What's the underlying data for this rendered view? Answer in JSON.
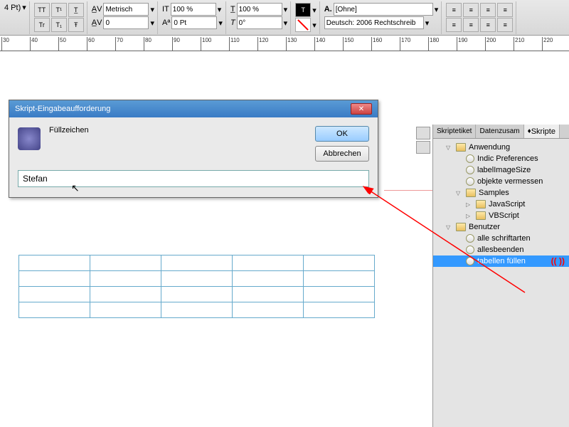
{
  "toolbar": {
    "pt_label": "4 Pt)",
    "metric": "Metrisch",
    "percent": "100 %",
    "zero_pt": "0 Pt",
    "zero_deg": "0°",
    "none": "[Ohne]",
    "lang": "Deutsch: 2006 Rechtschreib"
  },
  "ruler_ticks": [
    30,
    40,
    50,
    60,
    70,
    80,
    90,
    100,
    110,
    120,
    130,
    140,
    150,
    160,
    170,
    180,
    190,
    200,
    210,
    220
  ],
  "dialog": {
    "title": "Skript-Eingabeaufforderung",
    "label": "Füllzeichen",
    "ok": "OK",
    "cancel": "Abbrechen",
    "value": "Stefan"
  },
  "panel": {
    "tabs": [
      "Skriptetiket",
      "Datenzusam",
      "Skripte"
    ],
    "active_tab": 2,
    "tree": {
      "anwendung": "Anwendung",
      "indic": "Indic Preferences",
      "labelimg": "labelImageSize",
      "objekte": "objekte vermessen",
      "samples": "Samples",
      "javascript": "JavaScript",
      "vbscript": "VBScript",
      "benutzer": "Benutzer",
      "alleschrift": "alle schriftarten",
      "allesbeenden": "allesbeenden",
      "tabellen": "tabellen füllen"
    }
  }
}
